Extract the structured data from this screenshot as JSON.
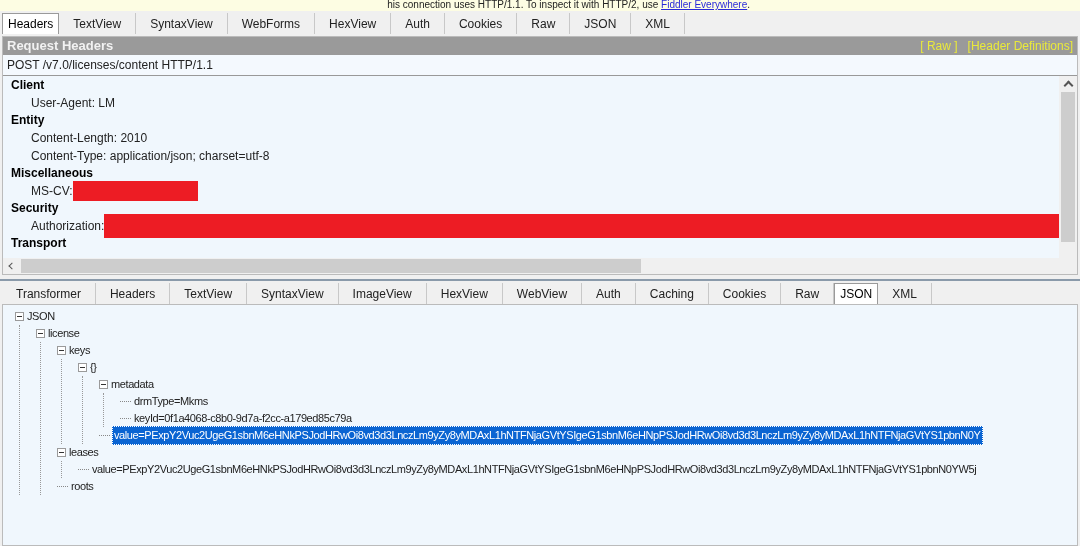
{
  "banner": {
    "text": "his connection uses HTTP/1.1. To inspect it with HTTP/2, use",
    "link": "Fiddler Everywhere",
    "end": "."
  },
  "request_tabs": [
    {
      "label": "Headers",
      "selected": true
    },
    {
      "label": "TextView",
      "selected": false
    },
    {
      "label": "SyntaxView",
      "selected": false
    },
    {
      "label": "WebForms",
      "selected": false
    },
    {
      "label": "HexView",
      "selected": false
    },
    {
      "label": "Auth",
      "selected": false
    },
    {
      "label": "Cookies",
      "selected": false
    },
    {
      "label": "Raw",
      "selected": false
    },
    {
      "label": "JSON",
      "selected": false
    },
    {
      "label": "XML",
      "selected": false
    }
  ],
  "request_headers": {
    "title": "Request Headers",
    "links": [
      "[ Raw ]",
      "[Header Definitions]"
    ],
    "request_line": "POST /v7.0/licenses/content HTTP/1.1",
    "groups": [
      {
        "name": "Client",
        "items": [
          {
            "text": "User-Agent: LM",
            "redacted": false
          }
        ]
      },
      {
        "name": "Entity",
        "items": [
          {
            "text": "Content-Length: 2010",
            "redacted": false
          },
          {
            "text": "Content-Type: application/json; charset=utf-8",
            "redacted": false
          }
        ]
      },
      {
        "name": "Miscellaneous",
        "items": [
          {
            "text": "MS-CV:",
            "redacted": true
          }
        ]
      },
      {
        "name": "Security",
        "items": [
          {
            "text": "Authorization:",
            "redacted": true,
            "wide": true
          }
        ]
      },
      {
        "name": "Transport"
      }
    ]
  },
  "response_tabs": [
    {
      "label": "Transformer",
      "selected": false
    },
    {
      "label": "Headers",
      "selected": false
    },
    {
      "label": "TextView",
      "selected": false
    },
    {
      "label": "SyntaxView",
      "selected": false
    },
    {
      "label": "ImageView",
      "selected": false
    },
    {
      "label": "HexView",
      "selected": false
    },
    {
      "label": "WebView",
      "selected": false
    },
    {
      "label": "Auth",
      "selected": false
    },
    {
      "label": "Caching",
      "selected": false
    },
    {
      "label": "Cookies",
      "selected": false
    },
    {
      "label": "Raw",
      "selected": false
    },
    {
      "label": "JSON",
      "selected": true
    },
    {
      "label": "XML",
      "selected": false
    }
  ],
  "json_tree": [
    {
      "label": "JSON",
      "expanded": true,
      "selected": false,
      "children": [
        {
          "label": "license",
          "expanded": true,
          "selected": false,
          "children": [
            {
              "label": "keys",
              "expanded": true,
              "selected": false,
              "children": [
                {
                  "label": "{}",
                  "expanded": true,
                  "selected": false,
                  "children": [
                    {
                      "label": "metadata",
                      "expanded": true,
                      "selected": false,
                      "children": [
                        {
                          "label": "drmType=Mkms",
                          "selected": false
                        },
                        {
                          "label": "keyId=0f1a4068-c8b0-9d7a-f2cc-a179ed85c79a",
                          "selected": false
                        }
                      ]
                    },
                    {
                      "label": "value=PExpY2Vuc2UgeG1sbnM6eHNkPSJodHRwOi8vd3d3LnczLm9yZy8yMDAxL1hNTFNjaGVtYSIgeG1sbnM6eHNpPSJodHRwOi8vd3d3LnczLm9yZy8yMDAxL1hNTFNjaGVtYS1pbnN0Y",
                      "selected": true
                    }
                  ]
                }
              ]
            },
            {
              "label": "leases",
              "expanded": true,
              "selected": false,
              "children": [
                {
                  "label": "value=PExpY2Vuc2UgeG1sbnM6eHNkPSJodHRwOi8vd3d3LnczLm9yZy8yMDAxL1hNTFNjaGVtYSIgeG1sbnM6eHNpPSJodHRwOi8vd3d3LnczLm9yZy8yMDAxL1hNTFNjaGVtYS1pbnN0YW5j",
                  "selected": false
                }
              ]
            },
            {
              "label": "roots",
              "selected": false
            }
          ]
        }
      ]
    }
  ]
}
